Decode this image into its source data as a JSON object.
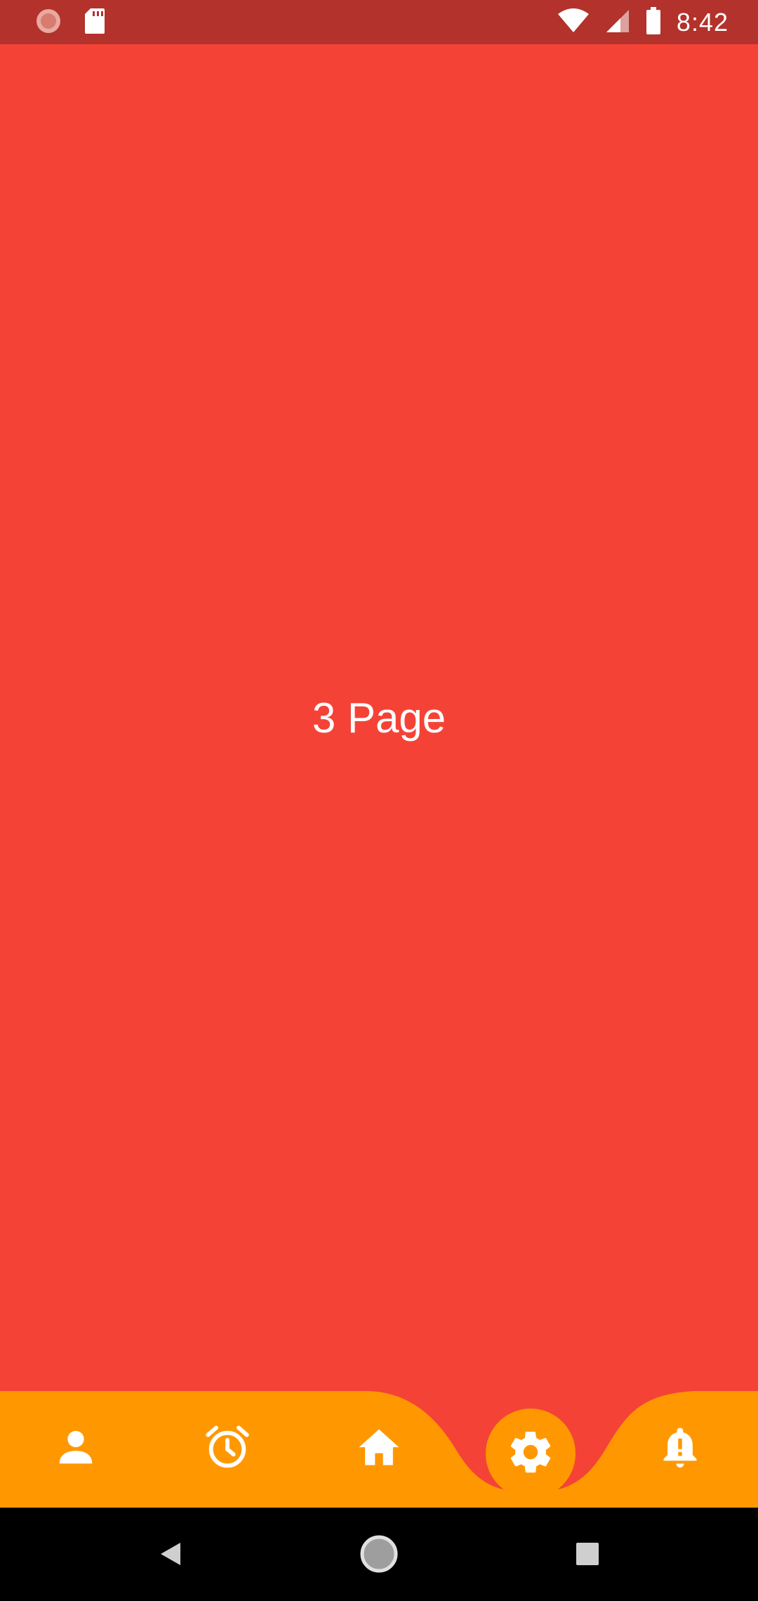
{
  "status_bar": {
    "time": "8:42",
    "background": "#b3322b",
    "icons_left": [
      "notification-dot-icon",
      "sd-card-icon"
    ],
    "icons_right": [
      "wifi-icon",
      "cell-signal-icon",
      "battery-icon"
    ]
  },
  "main": {
    "background": "#f44336",
    "label": "3 Page"
  },
  "bottom_nav": {
    "background": "#ff9800",
    "selected_index": 3,
    "items": [
      {
        "icon": "person-icon"
      },
      {
        "icon": "alarm-icon"
      },
      {
        "icon": "home-icon"
      },
      {
        "icon": "settings-gear-icon"
      },
      {
        "icon": "notification-bell-icon"
      }
    ]
  },
  "system_nav": {
    "buttons": [
      "back-icon",
      "home-circle-icon",
      "recents-icon"
    ]
  }
}
